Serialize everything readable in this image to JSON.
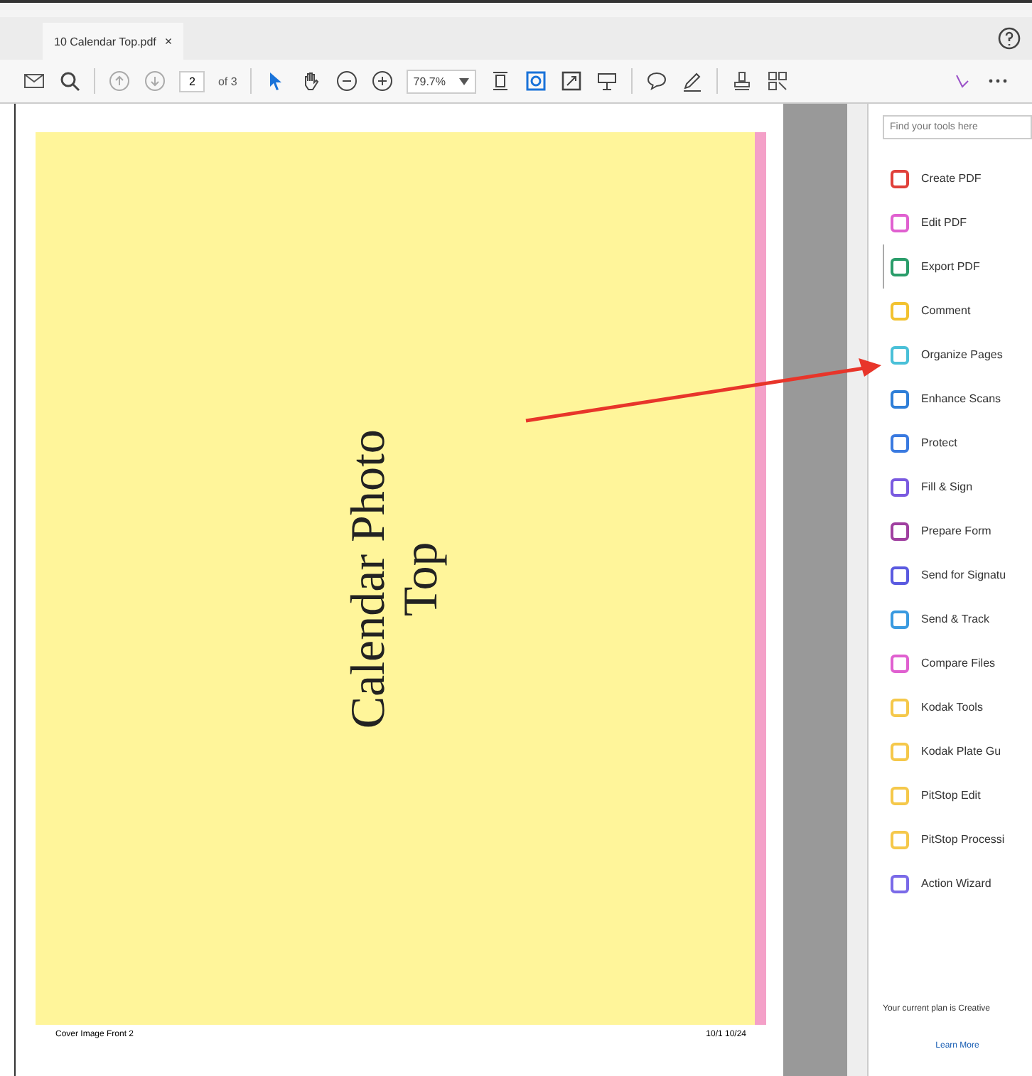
{
  "tabs": [
    {
      "label": "10 Calendar Top.pdf",
      "close": "×",
      "selected": true
    }
  ],
  "toolbar": {
    "page_number": "2",
    "page_count": "of 3",
    "zoom": "79.7%"
  },
  "page": {
    "title_lines": [
      "Calendar Photo",
      "Top"
    ],
    "footer_left": "Cover Image Front 2",
    "footer_right": "10/1 10/24"
  },
  "tools_panel": {
    "search": {
      "placeholder": "Find your tools here"
    },
    "items": [
      {
        "label": "Create PDF",
        "color": "#e0403a",
        "selected": false
      },
      {
        "label": "Edit PDF",
        "color": "#e060d0",
        "selected": false
      },
      {
        "label": "Export PDF",
        "color": "#2a9d6a",
        "selected": true
      },
      {
        "label": "Comment",
        "color": "#f2c230",
        "selected": false
      },
      {
        "label": "Organize Pages",
        "color": "#4ac0d8",
        "selected": false
      },
      {
        "label": "Enhance Scans",
        "color": "#2f7fd8",
        "selected": false
      },
      {
        "label": "Protect",
        "color": "#3a7ae0",
        "selected": false
      },
      {
        "label": "Fill & Sign",
        "color": "#7a5ae0",
        "selected": false
      },
      {
        "label": "Prepare Form",
        "color": "#a040a0",
        "selected": false
      },
      {
        "label": "Send for Signatu",
        "color": "#5a5ae0",
        "selected": false
      },
      {
        "label": "Send & Track",
        "color": "#3a9ae0",
        "selected": false
      },
      {
        "label": "Compare Files",
        "color": "#e060d0",
        "selected": false
      },
      {
        "label": "Kodak Tools",
        "color": "#f5c84a",
        "selected": false
      },
      {
        "label": "Kodak Plate Gu",
        "color": "#f5c84a",
        "selected": false
      },
      {
        "label": "PitStop Edit",
        "color": "#f5c84a",
        "selected": false
      },
      {
        "label": "PitStop Processi",
        "color": "#f5c84a",
        "selected": false
      },
      {
        "label": "Action Wizard",
        "color": "#7a6ae8",
        "selected": false
      }
    ],
    "plan_text": "Your current plan is Creative",
    "learn_more": "Learn More"
  }
}
